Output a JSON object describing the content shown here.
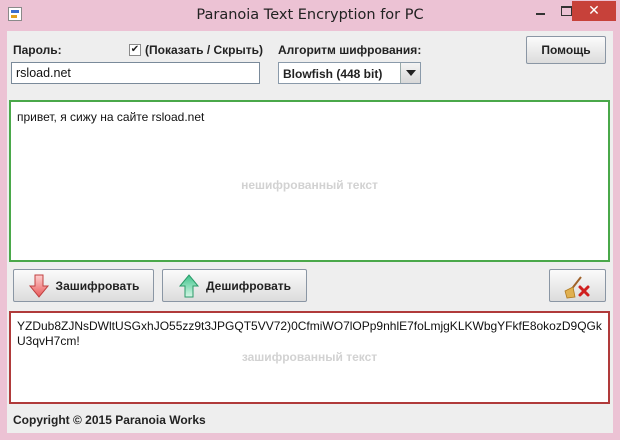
{
  "window": {
    "title": "Paranoia Text Encryption for PC",
    "minimize_glyph": "–",
    "maximize_glyph": "□",
    "close_glyph": "✕"
  },
  "password": {
    "label": "Пароль:",
    "value": "rsload.net"
  },
  "show_hide": {
    "label": "(Показать / Скрыть)",
    "checked": true,
    "check_glyph": "✔"
  },
  "algorithm": {
    "label": "Алгоритм шифрования:",
    "selected": "Blowfish (448 bit)"
  },
  "help_button": {
    "label": "Помощь"
  },
  "plain_area": {
    "text": "привет, я сижу на сайте rsload.net",
    "watermark": "нешифрованный текст",
    "border_color": "#4aa84a"
  },
  "actions": {
    "encrypt_label": "Зашифровать",
    "decrypt_label": "Дешифровать"
  },
  "cipher_area": {
    "text": "YZDub8ZJNsDWltUSGxhJO55zz9t3JPGQT5VV72)0CfmiWO7lOPp9nhlE7foLmjgKLKWbgYFkfE8okozD9QGkU3qvH7cm!",
    "watermark": "зашифрованный текст",
    "border_color": "#b03a3a"
  },
  "footer": {
    "text": "Copyright © 2015 Paranoia Works"
  },
  "colors": {
    "titlebar": "#ecc2d4",
    "close_button": "#c7413a",
    "client_bg": "#eeeeee"
  },
  "icons": {
    "encrypt": "arrow-down-icon",
    "decrypt": "arrow-up-icon",
    "clear": "broom-clear-icon",
    "app": "app-icon"
  }
}
